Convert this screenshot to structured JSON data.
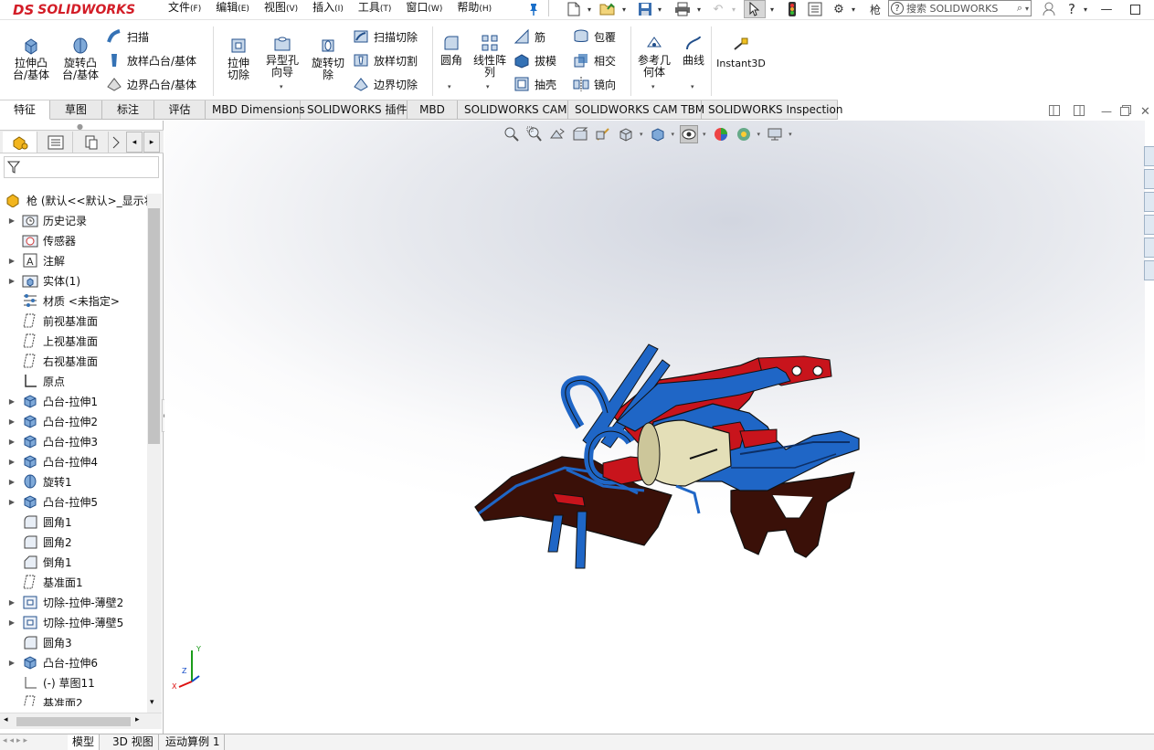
{
  "app": {
    "brand": "SOLIDWORKS",
    "brand_prefix": "DS",
    "doc_name": "枪"
  },
  "menu": [
    {
      "label": "文件",
      "key": "(F)"
    },
    {
      "label": "编辑",
      "key": "(E)"
    },
    {
      "label": "视图",
      "key": "(V)"
    },
    {
      "label": "插入",
      "key": "(I)"
    },
    {
      "label": "工具",
      "key": "(T)"
    },
    {
      "label": "窗口",
      "key": "(W)"
    },
    {
      "label": "帮助",
      "key": "(H)"
    }
  ],
  "search": {
    "placeholder": "搜索 SOLIDWORKS"
  },
  "ribbon": {
    "extrude_boss": "拉伸凸台/基体",
    "revolve_boss": "旋转凸台/基体",
    "sweep": "扫描",
    "loft_boss": "放样凸台/基体",
    "boundary_boss": "边界凸台/基体",
    "extrude_cut": "拉伸切除",
    "hole_wizard": "异型孔向导",
    "revolve_cut": "旋转切除",
    "swept_cut": "扫描切除",
    "loft_cut": "放样切割",
    "boundary_cut": "边界切除",
    "fillet": "圆角",
    "linear_pattern": "线性阵列",
    "rib": "筋",
    "draft": "拔模",
    "shell": "抽壳",
    "wrap": "包覆",
    "intersect": "相交",
    "mirror": "镜向",
    "ref_geometry": "参考几何体",
    "curves": "曲线",
    "instant3d": "Instant3D"
  },
  "command_tabs": [
    "特征",
    "草图",
    "标注",
    "评估",
    "MBD Dimensions",
    "SOLIDWORKS 插件",
    "MBD",
    "SOLIDWORKS CAM",
    "SOLIDWORKS CAM TBM",
    "SOLIDWORKS Inspection"
  ],
  "tree": {
    "root": "枪 (默认<<默认>_显示状",
    "items": [
      {
        "label": "历史记录",
        "icon": "history-folder-icon",
        "expand": true
      },
      {
        "label": "传感器",
        "icon": "sensor-icon",
        "expand": false
      },
      {
        "label": "注解",
        "icon": "annotation-icon",
        "expand": true
      },
      {
        "label": "实体(1)",
        "icon": "solid-bodies-icon",
        "expand": true
      },
      {
        "label": "材质 <未指定>",
        "icon": "material-icon",
        "expand": false
      },
      {
        "label": "前视基准面",
        "icon": "plane-icon",
        "expand": false
      },
      {
        "label": "上视基准面",
        "icon": "plane-icon",
        "expand": false
      },
      {
        "label": "右视基准面",
        "icon": "plane-icon",
        "expand": false
      },
      {
        "label": "原点",
        "icon": "origin-icon",
        "expand": false
      },
      {
        "label": "凸台-拉伸1",
        "icon": "boss-extrude-icon",
        "expand": true
      },
      {
        "label": "凸台-拉伸2",
        "icon": "boss-extrude-icon",
        "expand": true
      },
      {
        "label": "凸台-拉伸3",
        "icon": "boss-extrude-icon",
        "expand": true
      },
      {
        "label": "凸台-拉伸4",
        "icon": "boss-extrude-icon",
        "expand": true
      },
      {
        "label": "旋转1",
        "icon": "revolve-icon",
        "expand": true
      },
      {
        "label": "凸台-拉伸5",
        "icon": "boss-extrude-icon",
        "expand": true
      },
      {
        "label": "圆角1",
        "icon": "fillet-icon",
        "expand": false
      },
      {
        "label": "圆角2",
        "icon": "fillet-icon",
        "expand": false
      },
      {
        "label": "倒角1",
        "icon": "chamfer-icon",
        "expand": false
      },
      {
        "label": "基准面1",
        "icon": "plane-icon",
        "expand": false
      },
      {
        "label": "切除-拉伸-薄壁2",
        "icon": "cut-extrude-icon",
        "expand": true
      },
      {
        "label": "切除-拉伸-薄壁5",
        "icon": "cut-extrude-icon",
        "expand": true
      },
      {
        "label": "圆角3",
        "icon": "fillet-icon",
        "expand": false
      },
      {
        "label": "凸台-拉伸6",
        "icon": "boss-extrude-icon",
        "expand": true
      },
      {
        "label": "(-) 草图11",
        "icon": "sketch-icon",
        "expand": false
      },
      {
        "label": "基准面2",
        "icon": "plane-icon",
        "expand": false
      }
    ]
  },
  "bottom_tabs": [
    "模型",
    "3D 视图",
    "运动算例 1"
  ],
  "triad": {
    "x": "X",
    "y": "Y",
    "z": "Z"
  },
  "colors": {
    "accent_red": "#d31d27",
    "model_blue": "#1f66c6",
    "model_red": "#c8141c",
    "model_brown": "#3a1008",
    "model_cream": "#e4dfb8"
  }
}
